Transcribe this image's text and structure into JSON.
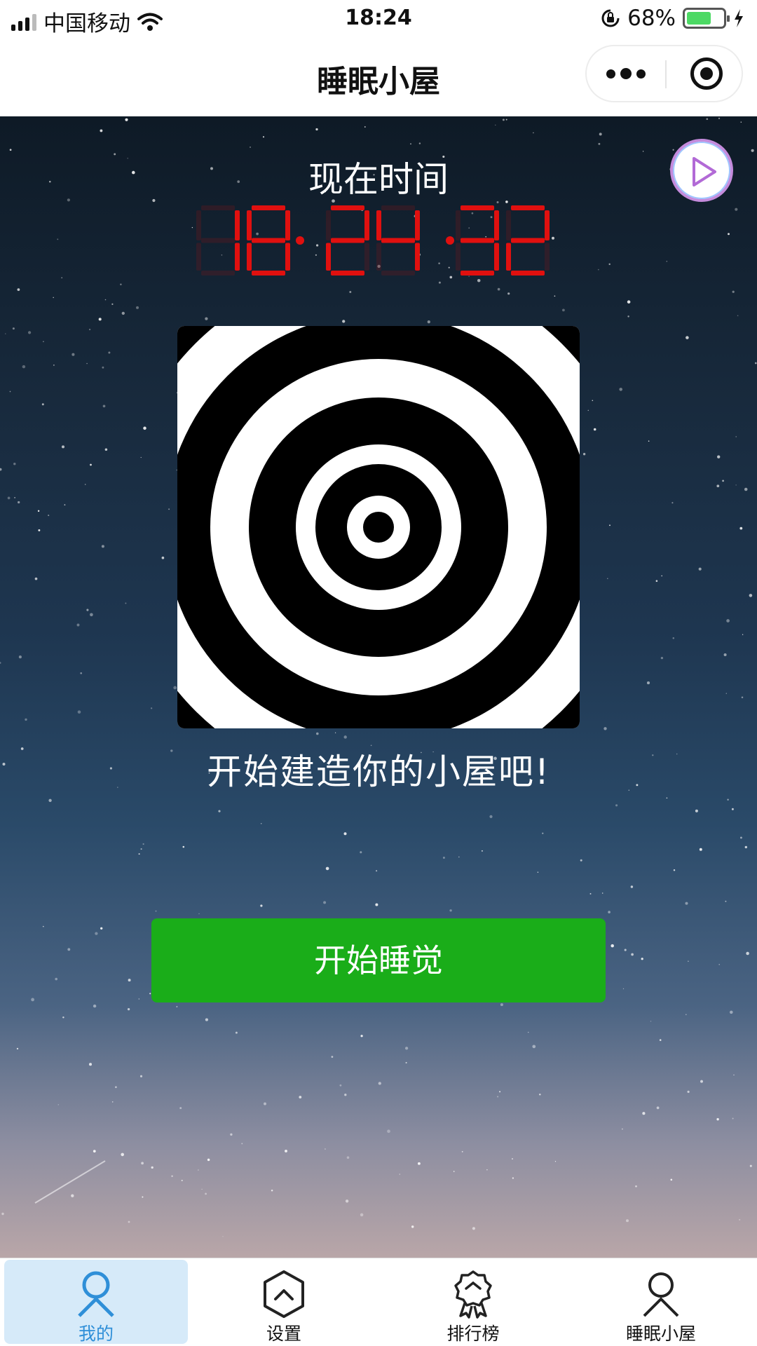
{
  "status_bar": {
    "carrier": "中国移动",
    "time": "18:24",
    "battery_percent": "68%",
    "battery_level": 0.68,
    "colors": {
      "battery": "#4cd964"
    }
  },
  "nav": {
    "title": "睡眠小屋",
    "icons": [
      "more-icon",
      "target-icon"
    ]
  },
  "main": {
    "clock_label": "现在时间",
    "clock_digits": "182432",
    "clock_color": "#e0100f",
    "tagline": "开始建造你的小屋吧!",
    "start_button": "开始睡觉",
    "button_color": "#1aad19"
  },
  "tabs": [
    {
      "label": "我的",
      "icon": "user-icon",
      "active": true
    },
    {
      "label": "设置",
      "icon": "hexagon-chevron-icon",
      "active": false
    },
    {
      "label": "排行榜",
      "icon": "award-icon",
      "active": false
    },
    {
      "label": "睡眠小屋",
      "icon": "person-icon",
      "active": false
    }
  ]
}
